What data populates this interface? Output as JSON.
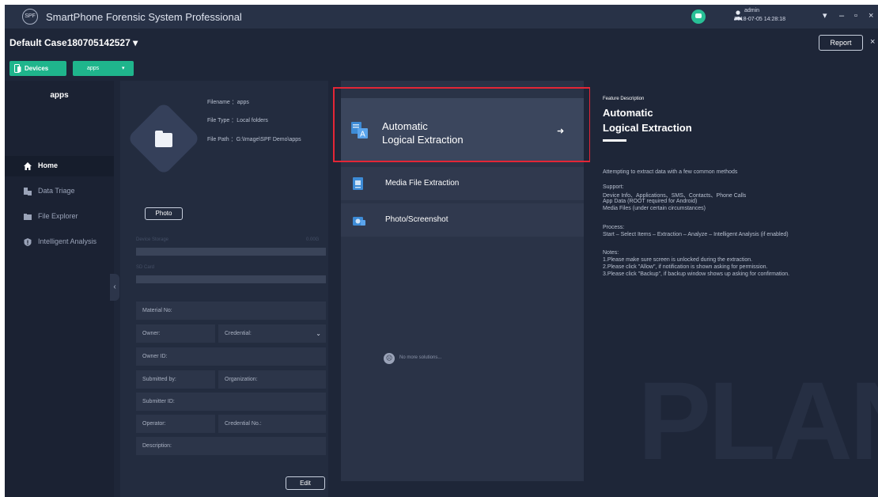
{
  "window": {
    "logo_text": "SPF",
    "title": "SmartPhone Forensic System Professional",
    "user": {
      "name": "admin",
      "datetime": "2018-07-05 14:28:18"
    },
    "controls": {
      "dropdown": "▾",
      "minimize": "–",
      "restore": "▫",
      "close": "×"
    }
  },
  "case": {
    "title": "Default Case180705142527",
    "dropdown": "▾",
    "report_label": "Report",
    "close": "×"
  },
  "tabs": {
    "devices_label": "Devices",
    "apps_label": "apps",
    "apps_chevron": "▾"
  },
  "sidebar": {
    "title": "apps",
    "items": [
      {
        "label": "Home",
        "icon": "home-icon"
      },
      {
        "label": "Data Triage",
        "icon": "triage-icon"
      },
      {
        "label": "File Explorer",
        "icon": "folder-icon"
      },
      {
        "label": "Intelligent Analysis",
        "icon": "analysis-icon"
      }
    ],
    "collapse_glyph": "‹"
  },
  "device": {
    "filename": "Filename ：apps",
    "filetype": "File Type ：Local folders",
    "filepath": "File Path ：G:\\Image\\SPF Demo\\apps",
    "photo_label": "Photo",
    "storage_label": "Device Storage",
    "storage_value": "0.00G",
    "sd_label": "SD Card",
    "fields": {
      "material_no": "Material No:",
      "owner": "Owner:",
      "credential": "Credential:",
      "owner_id": "Owner ID:",
      "submitted_by": "Submitted by:",
      "organization": "Organization:",
      "submitter_id": "Submitter ID:",
      "operator": "Operator:",
      "credential_no": "Credential No.:",
      "description": "Description:"
    },
    "credential_arrow": "⌄",
    "edit_label": "Edit"
  },
  "methods": {
    "auto_line1": "Automatic",
    "auto_line2": "Logical Extraction",
    "auto_arrow": "➜",
    "items": [
      {
        "label": "Media File Extraction",
        "icon": "media-file-icon"
      },
      {
        "label": "Photo/Screenshot",
        "icon": "camera-icon"
      }
    ],
    "no_solutions": "No more solutions..."
  },
  "description": {
    "caption": "Feature Description",
    "title_line1": "Automatic",
    "title_line2": "Logical Extraction",
    "summary": "Attempting to extract data with a few common methods",
    "support_header": "Support:",
    "support_lines": [
      "Device Info、Applications、SMS、Contacts、Phone Calls",
      "App Data (ROOT required for Android)",
      "Media Files (under certain circumstances)"
    ],
    "process_header": "Process:",
    "process_text": "Start – Select Items – Extraction – Analyze – Intelligent Analysis (if enabled)",
    "notes_header": "Notes:",
    "notes": [
      "1.Please make sure screen is unlocked during the extraction.",
      "2.Please click \"Allow\", if notification is shown asking for permission.",
      "3.Please click \"Backup\", if backup window shows up asking for confirmation."
    ],
    "watermark": "PLAN"
  },
  "colors": {
    "background": "#1e2638",
    "accent_green": "#1fb58c",
    "highlight_red": "#e32636"
  }
}
